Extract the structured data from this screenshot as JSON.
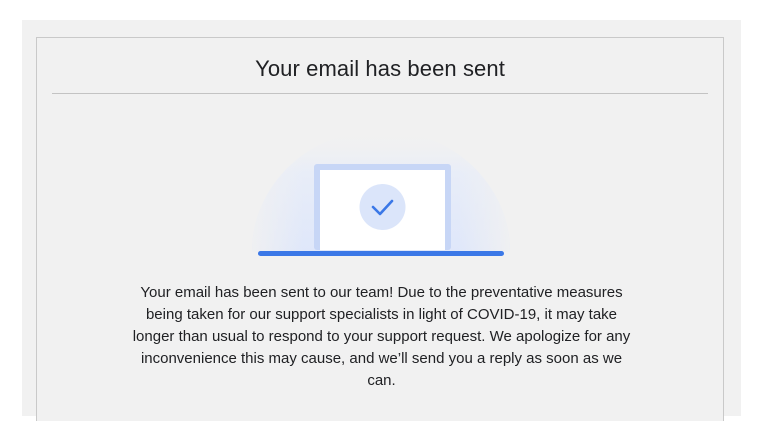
{
  "dialog": {
    "title": "Your email has been sent",
    "message": "Your email has been sent to our team! Due to the preventative measures being taken for our support specialists in light of COVID-19, it may take longer than usual to respond to your support request. We apologize for any inconvenience this may cause, and we’ll send you a reply as soon as we can."
  },
  "illustration": {
    "icon": "laptop-checkmark-icon",
    "accent_color": "#3b78e7",
    "halo_color": "#e3eafb"
  }
}
